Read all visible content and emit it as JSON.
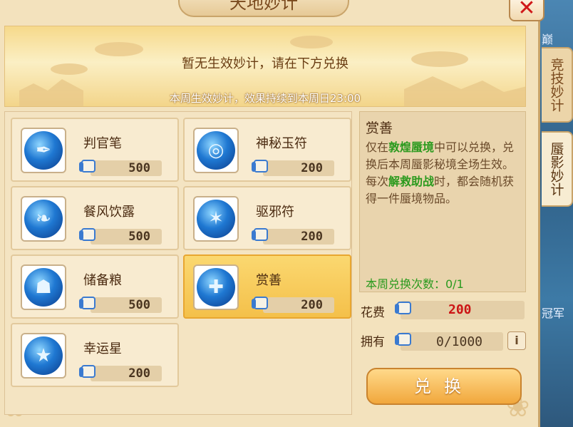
{
  "title": "天地妙计",
  "banner": {
    "message": "暂无生效妙计，请在下方兑换",
    "subtitle": "本周生效妙计，效果持续到本周日23:00"
  },
  "items": [
    {
      "name": "判官笔",
      "price": "500",
      "icon": "brush-icon",
      "glyph": "✒"
    },
    {
      "name": "神秘玉符",
      "price": "200",
      "icon": "jade-talisman-icon",
      "glyph": "◎"
    },
    {
      "name": "餐风饮露",
      "price": "500",
      "icon": "leaf-icon",
      "glyph": "❧"
    },
    {
      "name": "驱邪符",
      "price": "200",
      "icon": "scroll-charm-icon",
      "glyph": "✶"
    },
    {
      "name": "储备粮",
      "price": "500",
      "icon": "grain-bag-icon",
      "glyph": "☗"
    },
    {
      "name": "赏善",
      "price": "200",
      "icon": "gift-box-icon",
      "glyph": "✚"
    },
    {
      "name": "幸运星",
      "price": "200",
      "icon": "lucky-star-icon",
      "glyph": "★"
    }
  ],
  "selected_index": 5,
  "detail": {
    "title": "赏善",
    "desc_1": "仅在",
    "desc_hl_1": "敦煌蜃境",
    "desc_2": "中可以兑换，兑换后本周蜃影秘境全场生效。每次",
    "desc_hl_2": "解救助战",
    "desc_3": "时，都会随机获得一件蜃境物品。",
    "weekly_count": "本周兑换次数：0/1"
  },
  "cost": {
    "label": "花费",
    "value": "200"
  },
  "own": {
    "label": "拥有",
    "value": "0/1000"
  },
  "info_label": "i",
  "close_label": "✕",
  "exchange_label": "兑换",
  "side_tabs": [
    {
      "label": "竞技妙计",
      "active": false
    },
    {
      "label": "蜃影妙计",
      "active": true
    }
  ],
  "bg_labels": [
    "巅",
    "冠军"
  ],
  "colors": {
    "accent": "#f1a73c",
    "highlight": "#2b9a1e",
    "cost": "#cc1515"
  }
}
